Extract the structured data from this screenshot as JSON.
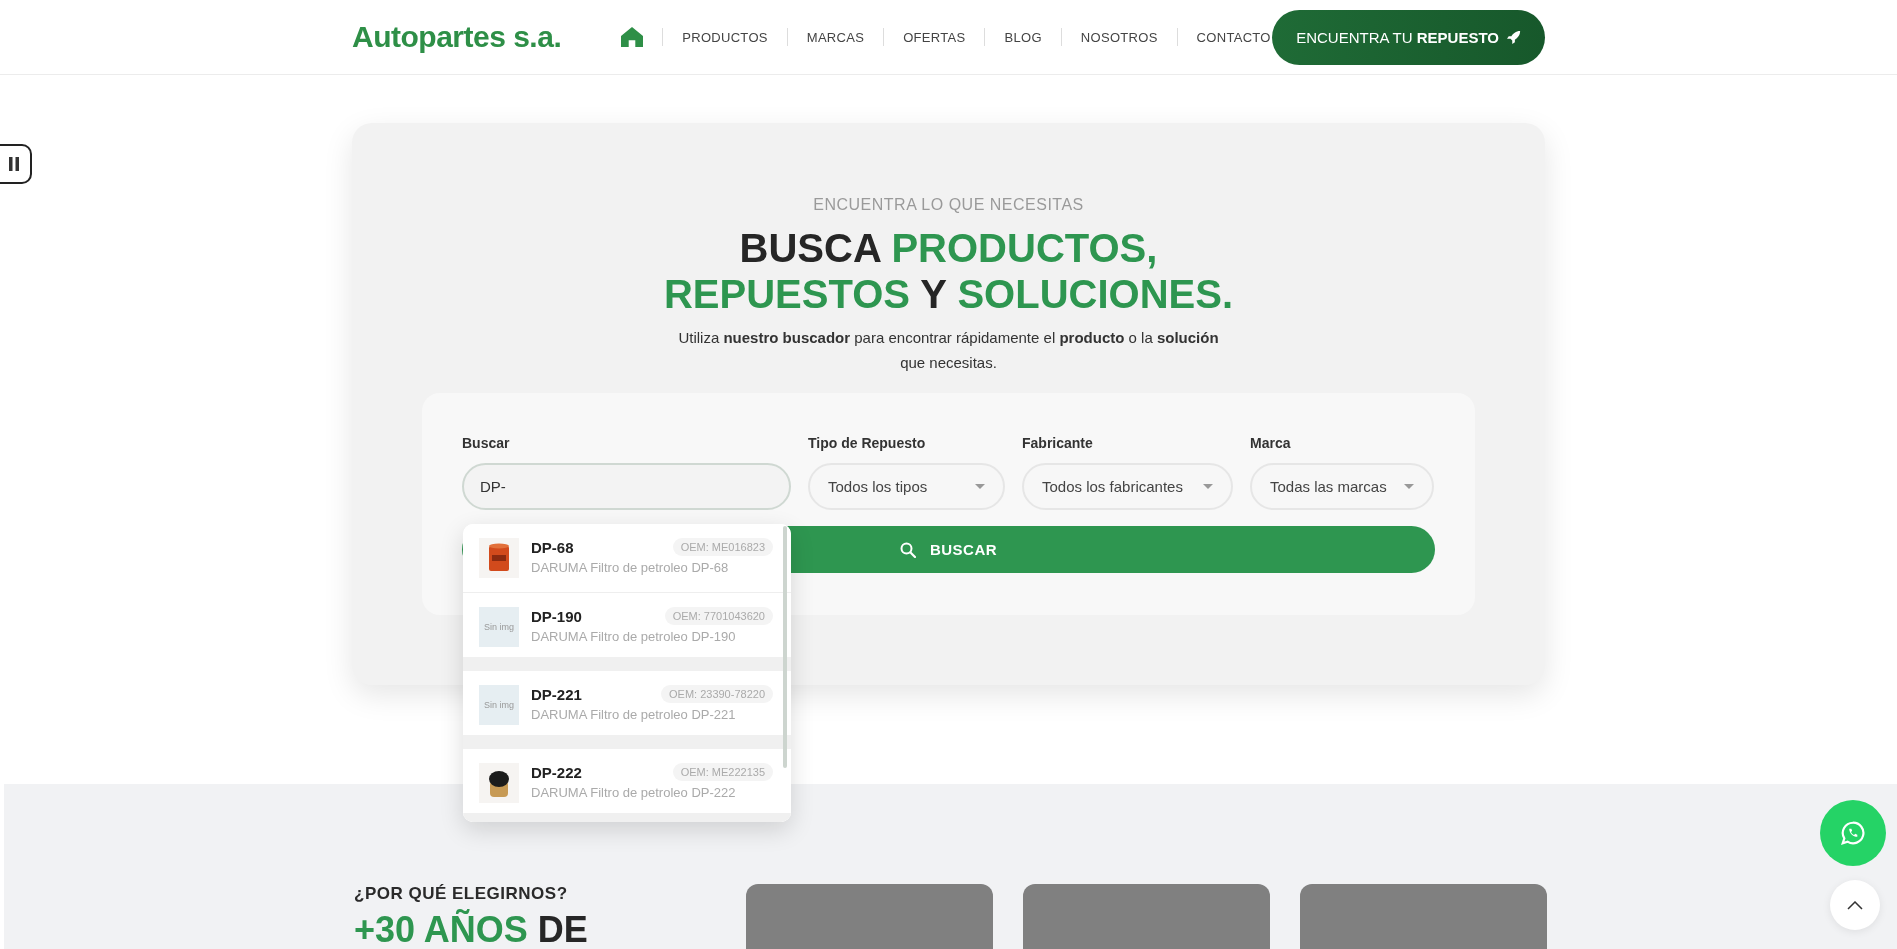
{
  "header": {
    "logo": "Autopartes s.a.",
    "home": {
      "selected": true
    },
    "nav": [
      {
        "label": "PRODUCTOS",
        "selected": false
      },
      {
        "label": "MARCAS",
        "selected": false
      },
      {
        "label": "OFERTAS",
        "selected": false
      },
      {
        "label": "BLOG",
        "selected": false
      },
      {
        "label": "NOSOTROS",
        "selected": false
      },
      {
        "label": "CONTACTO",
        "selected": false
      }
    ],
    "cta": "ENCUENTRA TU **REPUESTO**"
  },
  "hero": {
    "eyebrow": "ENCUENTRA LO QUE NECESITAS",
    "heading": [
      [
        {
          "text": "BUSCA ",
          "highlight": false
        },
        {
          "text": "PRODUCTOS,",
          "highlight": true
        }
      ],
      [
        {
          "text": "REPUESTOS",
          "highlight": true
        },
        {
          "text": " Y ",
          "highlight": false
        },
        {
          "text": "SOLUCIONES.",
          "highlight": true
        }
      ]
    ],
    "intro": "Utiliza **nuestro buscador** para encontrar rápidamente el **producto** o la **solución** que necesitas.",
    "search": {
      "label": "Buscar",
      "value": "DP-",
      "filters": [
        {
          "label": "Tipo de Repuesto",
          "value": "Todos los tipos"
        },
        {
          "label": "Fabricante",
          "value": "Todos los fabricantes"
        },
        {
          "label": "Marca",
          "value": "Todas las marcas"
        }
      ],
      "button": "BUSCAR",
      "suggestions": [
        {
          "code": "DP-68",
          "oem": "OEM: ME016823",
          "description": "DARUMA Filtro de petroleo DP-68"
        },
        {
          "code": "DP-190",
          "oem": "OEM: 7701043620",
          "description": "DARUMA Filtro de petroleo DP-190",
          "kind": "no_image",
          "no_image_text": "Sin img"
        },
        {
          "code": "DP-221",
          "oem": "OEM: 23390-78220",
          "description": "DARUMA Filtro de petroleo DP-221",
          "kind": "no_image",
          "no_image_text": "Sin img"
        },
        {
          "code": "DP-222",
          "oem": "OEM: ME222135",
          "description": "DARUMA Filtro de petroleo DP-222"
        }
      ]
    }
  },
  "why": {
    "eyebrow": "¿POR QUÉ ELEGIRNOS?",
    "heading": [
      {
        "text": "+30 AÑOS",
        "highlight": true
      },
      {
        "text": " DE",
        "highlight": false
      }
    ]
  }
}
